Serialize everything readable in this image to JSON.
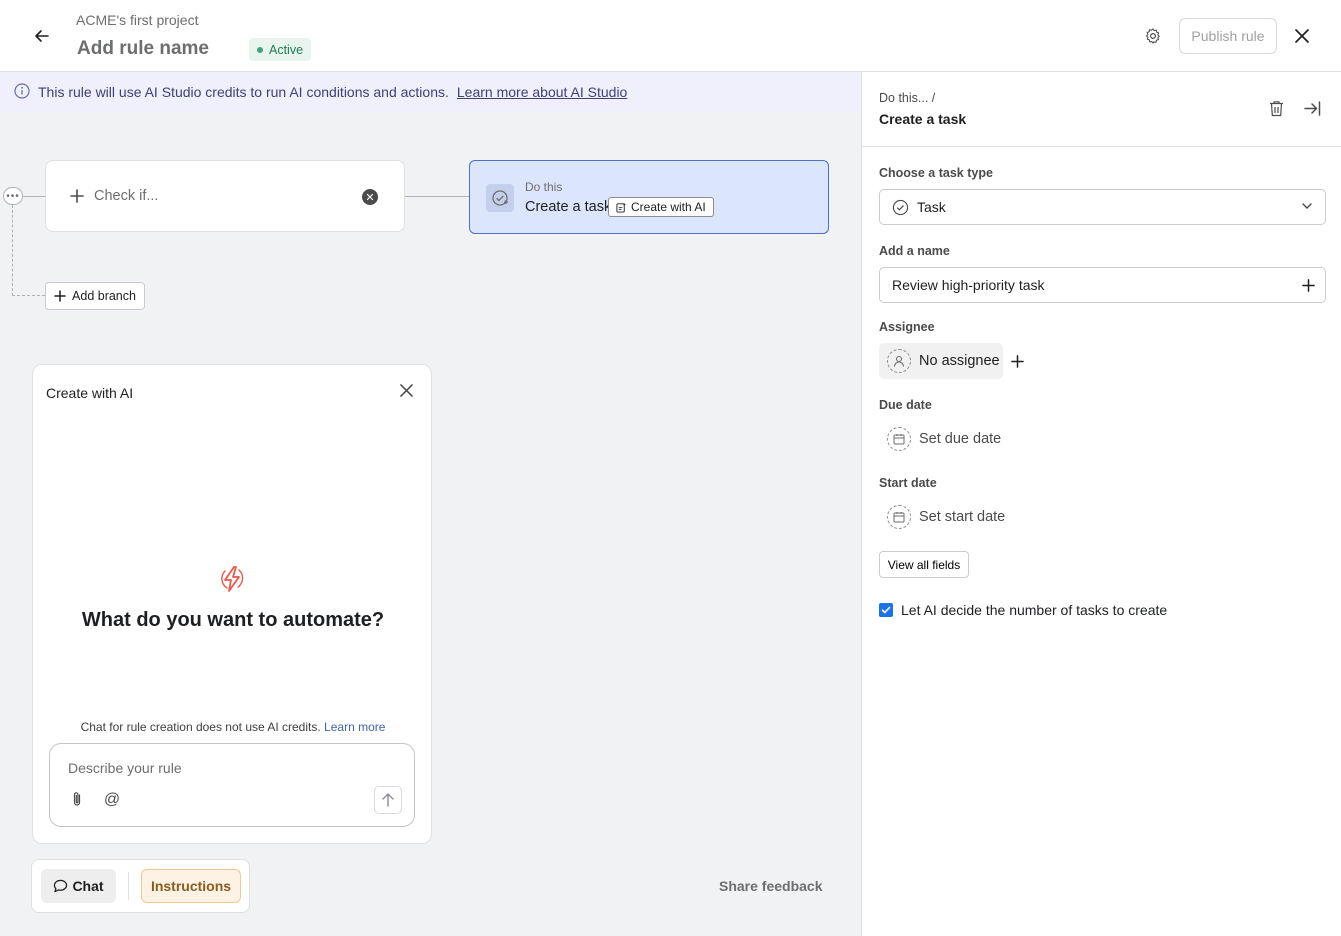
{
  "header": {
    "project_name": "ACME's first project",
    "rule_name": "Add rule name",
    "status": "Active",
    "publish_label": "Publish rule"
  },
  "banner": {
    "text": "This rule will use AI Studio credits to run AI conditions and actions.",
    "link": "Learn more about AI Studio"
  },
  "canvas": {
    "check_label": "Check if...",
    "do_kicker": "Do this",
    "do_title": "Create a task",
    "create_ai_chip": "Create with AI",
    "add_branch": "Add branch"
  },
  "ai_panel": {
    "title": "Create with AI",
    "prompt": "What do you want to automate?",
    "note": "Chat for rule creation does not use AI credits.",
    "note_link": "Learn more",
    "input_placeholder": "Describe your rule"
  },
  "bottom": {
    "chat": "Chat",
    "instructions": "Instructions",
    "share_feedback": "Share feedback"
  },
  "right_panel": {
    "breadcrumb": "Do this...  /",
    "title": "Create a task",
    "task_type_label": "Choose a task type",
    "task_type_value": "Task",
    "name_label": "Add a name",
    "name_value": "Review high-priority task",
    "assignee_label": "Assignee",
    "assignee_value": "No assignee",
    "due_label": "Due date",
    "due_value": "Set due date",
    "start_label": "Start date",
    "start_value": "Set start date",
    "view_all": "View all fields",
    "ai_decide": "Let AI decide the number of tasks to create",
    "ai_decide_checked": true
  },
  "colors": {
    "accent_blue": "#4f6fc9",
    "active_green": "#3aa57a",
    "bolt_red": "#e8584a",
    "checkbox_blue": "#1a73e8"
  }
}
